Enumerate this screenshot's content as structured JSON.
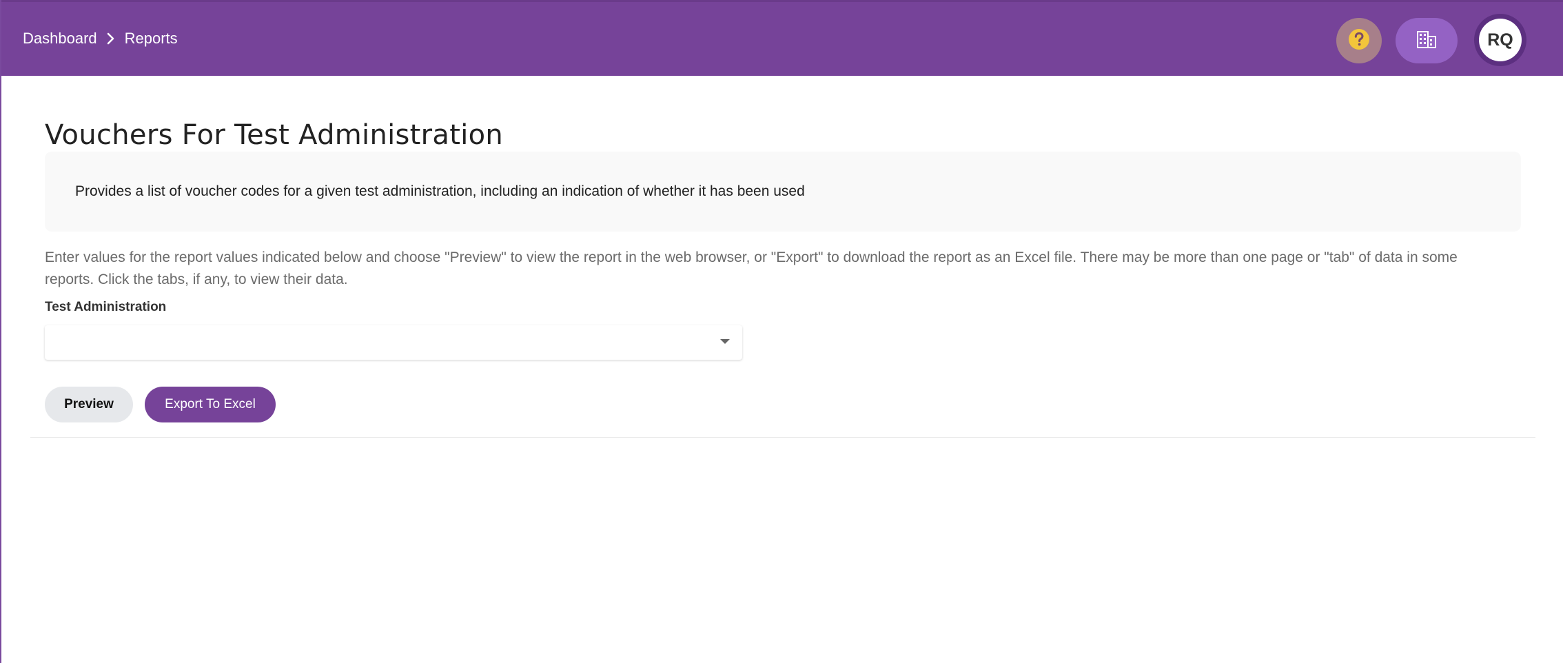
{
  "colors": {
    "header": "#764399",
    "accent": "#764399",
    "help_bg": "#a77f8a",
    "help_icon": "#f3c53b",
    "org_bg": "#9462c4"
  },
  "header": {
    "breadcrumb": [
      {
        "label": "Dashboard"
      },
      {
        "label": "Reports"
      }
    ],
    "icons": {
      "help": "question-icon",
      "organization": "building-icon",
      "separator": "chevron-right-icon"
    },
    "avatar_initials": "RQ"
  },
  "main": {
    "title": "Vouchers For Test Administration",
    "description": "Provides a list of voucher codes for a given test administration, including an indication of whether it has been used",
    "instructions": "Enter values for the report values indicated below and choose \"Preview\" to view the report in the web browser, or \"Export\" to download the report as an Excel file. There may be more than one page or \"tab\" of data in some reports. Click the tabs, if any, to view their data.",
    "fields": {
      "test_administration": {
        "label": "Test Administration",
        "value": ""
      }
    },
    "buttons": {
      "preview": "Preview",
      "export": "Export To Excel"
    }
  }
}
